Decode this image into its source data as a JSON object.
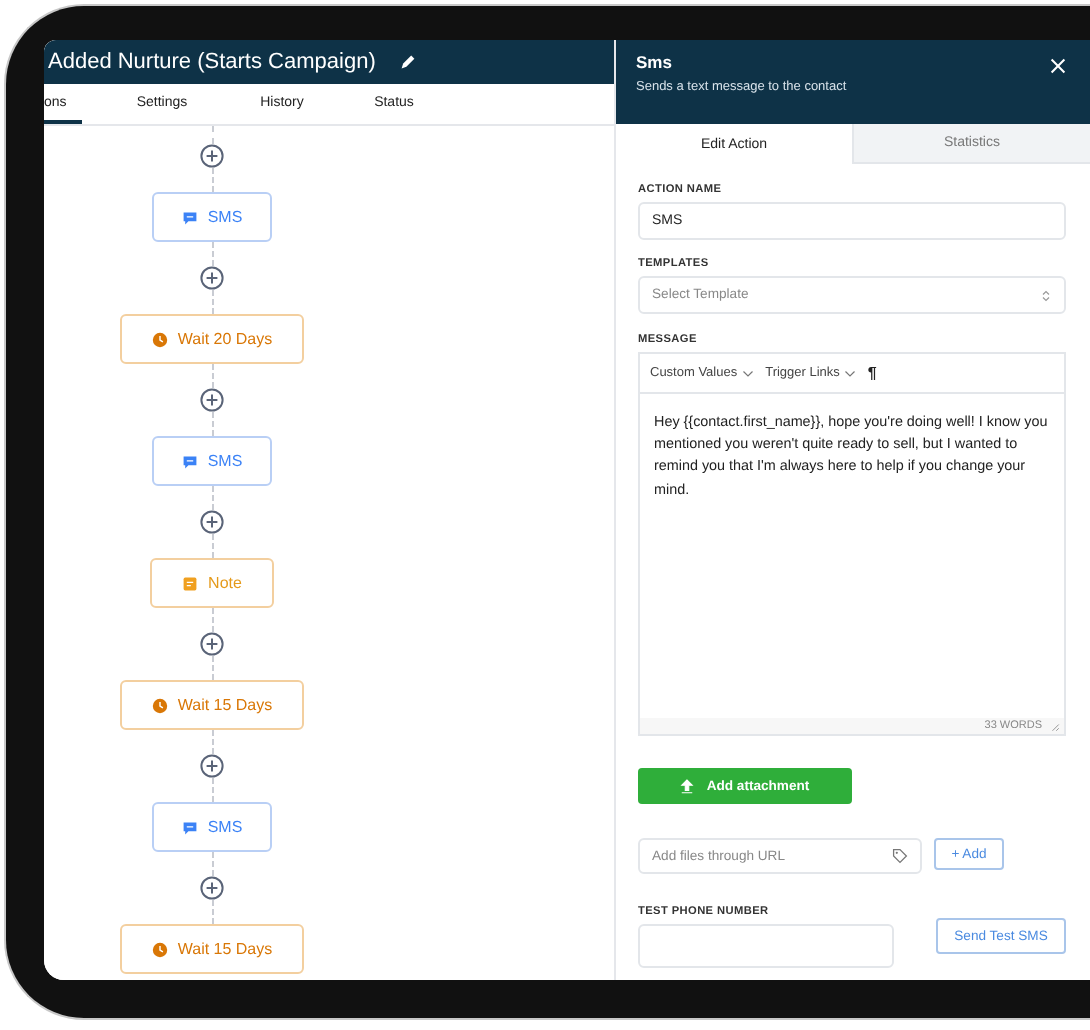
{
  "workflow": {
    "title": "Added Nurture (Starts Campaign)",
    "tabs": [
      {
        "label": "ons",
        "selected": true
      },
      {
        "label": "Settings",
        "selected": false
      },
      {
        "label": "History",
        "selected": false
      },
      {
        "label": "Status",
        "selected": false
      }
    ],
    "nodes": [
      {
        "kind": "sms",
        "label": "SMS"
      },
      {
        "kind": "wait",
        "label": "Wait 20 Days"
      },
      {
        "kind": "sms",
        "label": "SMS"
      },
      {
        "kind": "note",
        "label": "Note"
      },
      {
        "kind": "wait",
        "label": "Wait 15 Days"
      },
      {
        "kind": "sms",
        "label": "SMS"
      },
      {
        "kind": "wait",
        "label": "Wait 15 Days"
      }
    ]
  },
  "panel": {
    "title": "Sms",
    "subtitle": "Sends a text message to the contact",
    "tabs": [
      {
        "label": "Edit Action",
        "selected": true
      },
      {
        "label": "Statistics",
        "selected": false
      }
    ],
    "action_name": {
      "label": "ACTION NAME",
      "value": "SMS"
    },
    "templates": {
      "label": "TEMPLATES",
      "placeholder": "Select Template"
    },
    "message": {
      "label": "MESSAGE",
      "toolbar": [
        "Custom Values",
        "Trigger Links"
      ],
      "paragraph_symbol": "¶",
      "value": "Hey {{contact.first_name}}, hope you're doing well! I know you mentioned you weren't quite ready to sell, but I wanted to remind you that I'm always here to help if you change your mind.",
      "word_count": "33 WORDS"
    },
    "attachment_button": "Add attachment",
    "url_field": {
      "placeholder": "Add files through URL"
    },
    "add_button": "+ Add",
    "test_phone": {
      "label": "TEST PHONE NUMBER",
      "button": "Send Test SMS"
    }
  }
}
